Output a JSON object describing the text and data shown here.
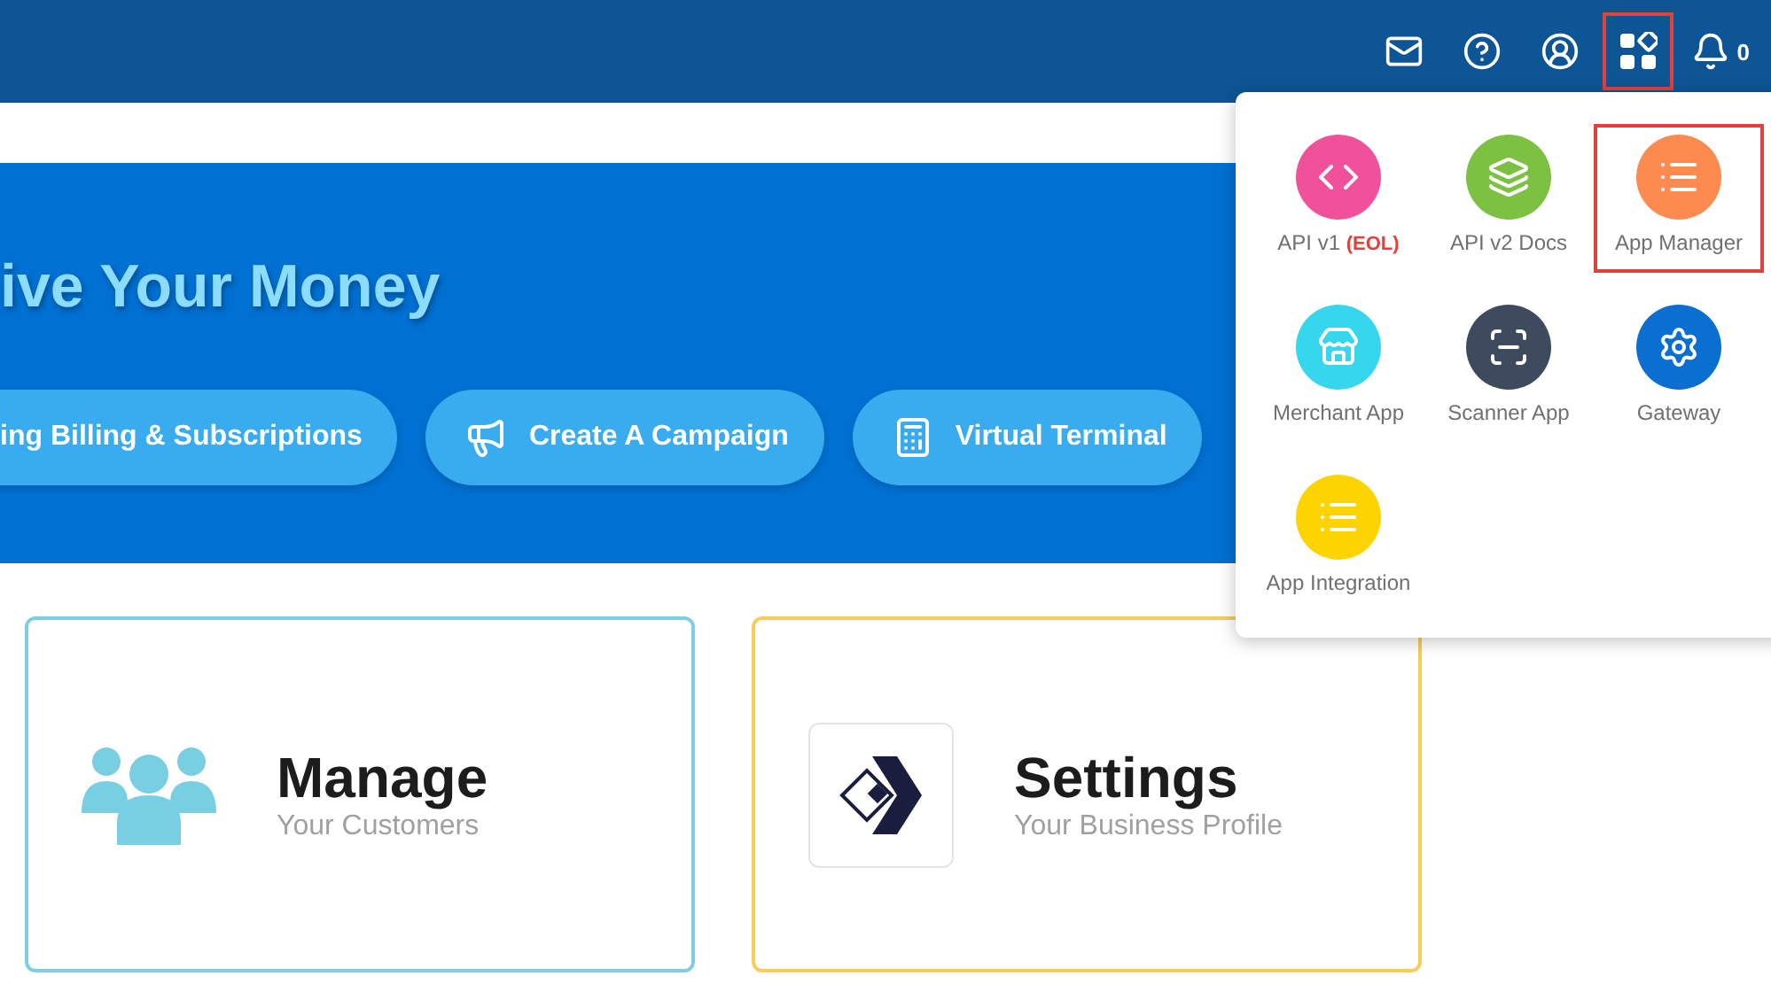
{
  "top_bar": {
    "icons": [
      {
        "kind": "mail",
        "selected": false
      },
      {
        "kind": "help",
        "selected": false
      },
      {
        "kind": "account",
        "selected": false
      },
      {
        "kind": "apps",
        "selected": true
      },
      {
        "kind": "bell",
        "selected": false,
        "count": "0"
      }
    ]
  },
  "banner": {
    "heading": "ive Your Money",
    "buttons": [
      {
        "kind": "none",
        "label": "ing Billing & Subscriptions"
      },
      {
        "kind": "megaphone",
        "label": "Create A Campaign"
      },
      {
        "kind": "calculator",
        "label": "Virtual Terminal"
      }
    ]
  },
  "cards": [
    {
      "kind": "people",
      "title": "Manage",
      "subtitle": "Your Customers",
      "color": "#7ccfe0"
    },
    {
      "kind": "logo",
      "title": "Settings",
      "subtitle": "Your Business Profile",
      "color": "#f7cd58"
    }
  ],
  "apps_menu": {
    "items": [
      {
        "kind": "code",
        "label": "API v1",
        "tag": "(EOL)",
        "color": "#f0519a",
        "selected": false
      },
      {
        "kind": "docs",
        "label": "API v2 Docs",
        "color": "#7cc142",
        "selected": false
      },
      {
        "kind": "list",
        "label": "App Manager",
        "color": "#fd8a4f",
        "selected": true
      },
      {
        "kind": "store",
        "label": "Merchant App",
        "color": "#36d6ee",
        "selected": false
      },
      {
        "kind": "scanner",
        "label": "Scanner App",
        "color": "#3e4a5e",
        "selected": false
      },
      {
        "kind": "gear",
        "label": "Gateway",
        "color": "#0a6fd1",
        "selected": false
      },
      {
        "kind": "list",
        "label": "App Integration",
        "color": "#fdd300",
        "selected": false
      }
    ]
  }
}
